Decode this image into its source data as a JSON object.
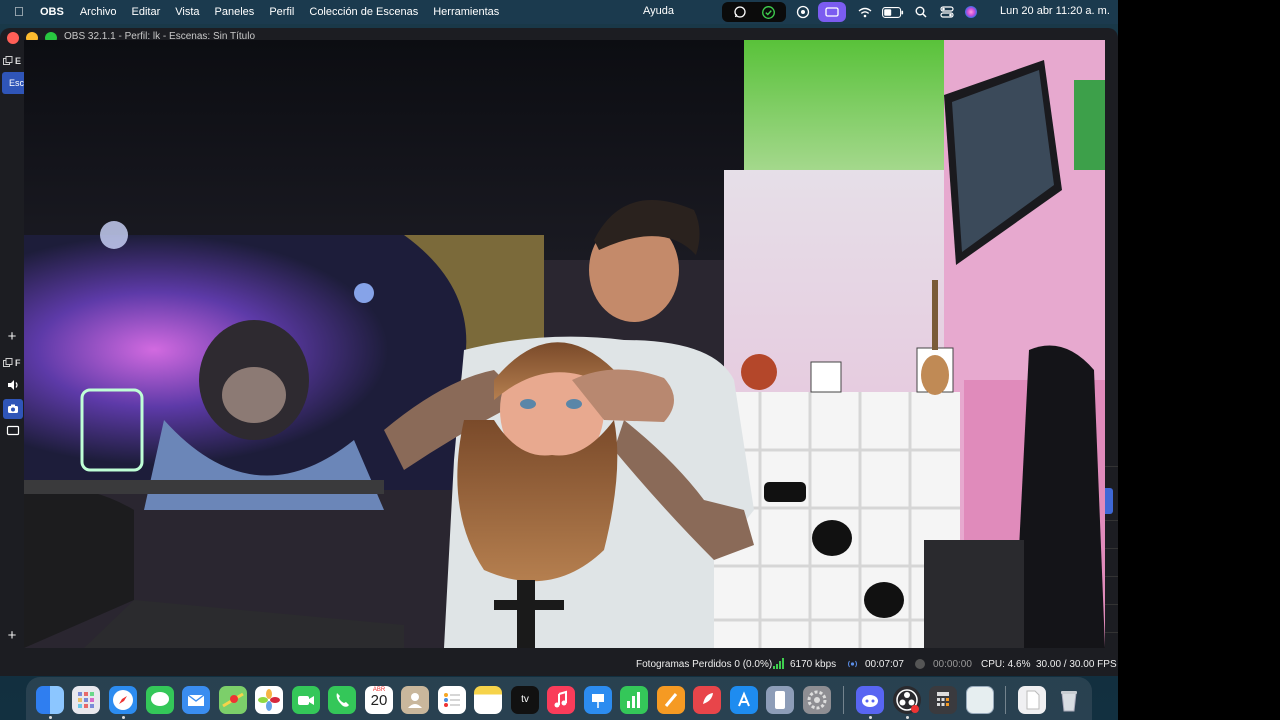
{
  "menubar": {
    "app_name": "OBS",
    "items": [
      "Archivo",
      "Editar",
      "Vista",
      "Paneles",
      "Perfil",
      "Colección de Escenas",
      "Herramientas"
    ],
    "help": "Ayuda",
    "clock": "Lun 20 abr  11:20 a. m."
  },
  "window": {
    "title": "OBS 32.1.1 - Perfil: lk - Escenas: Sin Título"
  },
  "left_dock": {
    "scenes_label": "E",
    "scene_item": "Esc",
    "sources_label": "F"
  },
  "statusbar": {
    "dropped_frames": "Fotogramas Perdidos 0 (0.0%)",
    "bitrate": "6170 kbps",
    "stream_time": "00:07:07",
    "record_time": "00:00:00",
    "cpu": "CPU: 4.6%",
    "fps": "30.00 / 30.00 FPS"
  },
  "dock": {
    "calendar_month": "ABR",
    "calendar_day": "20",
    "tv_label": "tv"
  },
  "colors": {
    "accent": "#2f55b8",
    "menubar": "#1b3a4e",
    "window_bg": "#1c1d22",
    "bitrate_green": "#3fcf4f"
  },
  "icons": [
    "apple-icon",
    "whatsapp-icon",
    "check-icon",
    "airdrop-icon",
    "screen-mirror-icon",
    "wifi-icon",
    "battery-icon",
    "search-icon",
    "control-center-icon",
    "siri-icon",
    "plus-icon",
    "speaker-icon",
    "camera-icon",
    "display-icon"
  ]
}
